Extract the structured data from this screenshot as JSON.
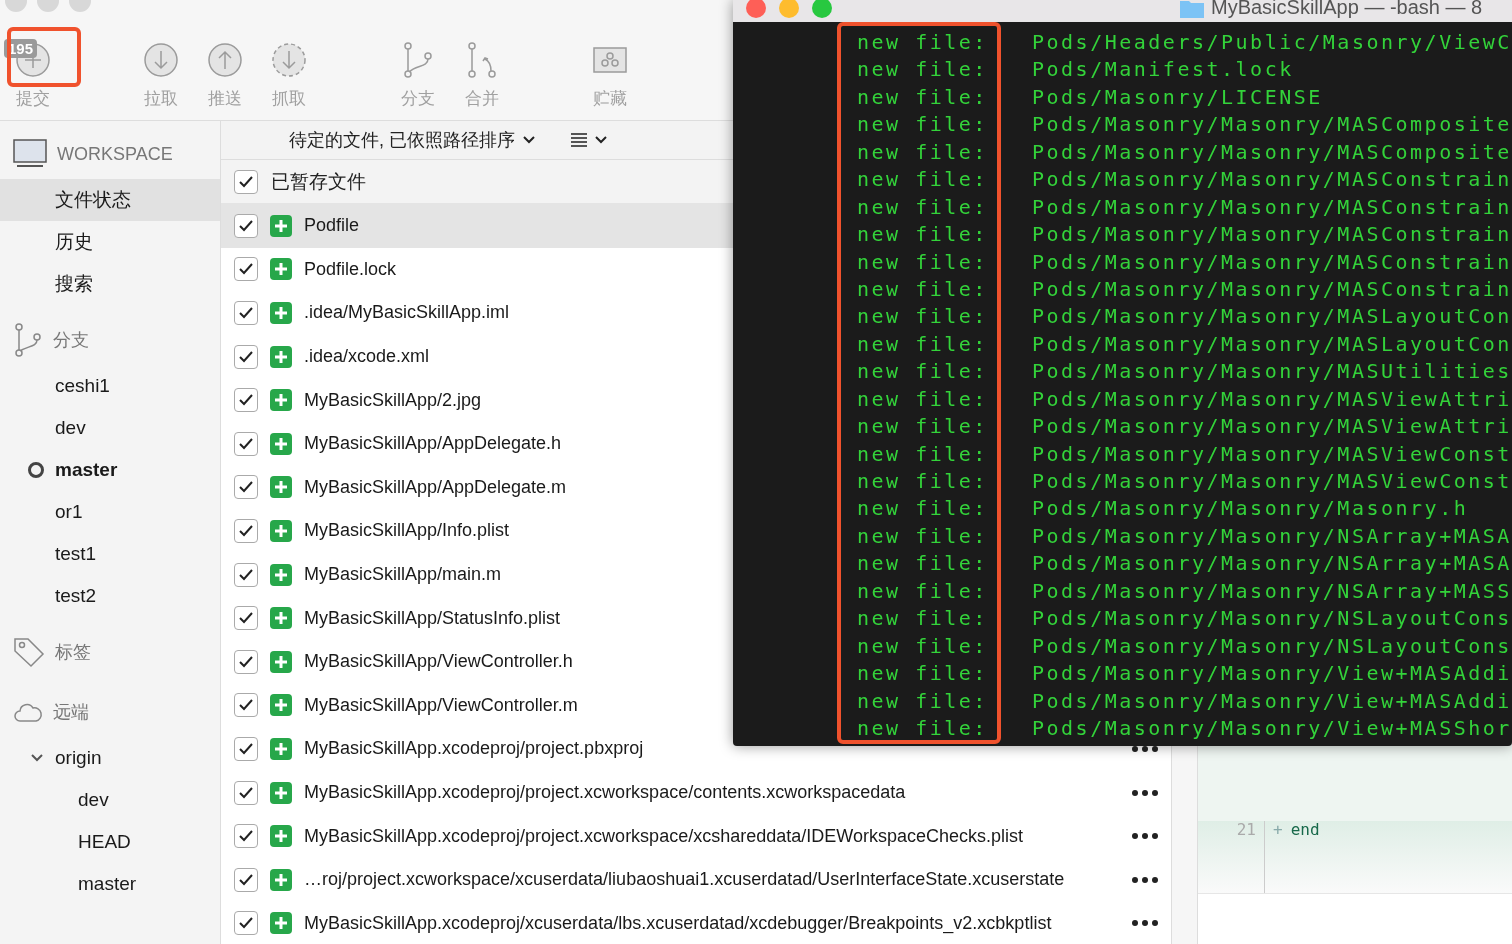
{
  "toolbar": [
    {
      "kind": "commit",
      "label": "提交",
      "badge": "195",
      "highlighted": true
    },
    {
      "kind": "pull",
      "label": "拉取",
      "highlighted": false
    },
    {
      "kind": "push",
      "label": "推送",
      "highlighted": false
    },
    {
      "kind": "fetch",
      "label": "抓取",
      "highlighted": false
    },
    {
      "kind": "branch",
      "label": "分支",
      "highlighted": false
    },
    {
      "kind": "merge",
      "label": "合并",
      "highlighted": false
    },
    {
      "kind": "stash",
      "label": "贮藏",
      "highlighted": false
    }
  ],
  "sidebar": [
    {
      "kind": "workspace",
      "title": "WORKSPACE",
      "items": [
        {
          "label": "文件状态",
          "selected": true
        },
        {
          "label": "历史",
          "selected": false
        },
        {
          "label": "搜索",
          "selected": false
        }
      ]
    },
    {
      "kind": "branches",
      "title": "分支",
      "items": [
        {
          "label": "ceshi1",
          "current": false
        },
        {
          "label": "dev",
          "current": false
        },
        {
          "label": "master",
          "current": true
        },
        {
          "label": "or1",
          "current": false
        },
        {
          "label": "test1",
          "current": false
        },
        {
          "label": "test2",
          "current": false
        }
      ]
    },
    {
      "kind": "tags",
      "title": "标签"
    },
    {
      "kind": "remotes",
      "title": "远端",
      "items": [
        {
          "label": "origin",
          "expanded": true,
          "children": [
            {
              "label": "dev"
            },
            {
              "label": "HEAD"
            },
            {
              "label": "master"
            }
          ]
        }
      ]
    }
  ],
  "file_list": {
    "sort_label": "待定的文件, 已依照路径排序",
    "staged": {
      "label": "已暂存文件",
      "checked": true
    },
    "files": [
      {
        "path": "Podfile",
        "checked": true,
        "selected": true,
        "more": false
      },
      {
        "path": "Podfile.lock",
        "checked": true,
        "selected": false,
        "more": false
      },
      {
        "path": ".idea/MyBasicSkillApp.iml",
        "checked": true,
        "selected": false,
        "more": false
      },
      {
        "path": ".idea/xcode.xml",
        "checked": true,
        "selected": false,
        "more": false
      },
      {
        "path": "MyBasicSkillApp/2.jpg",
        "checked": true,
        "selected": false,
        "more": false
      },
      {
        "path": "MyBasicSkillApp/AppDelegate.h",
        "checked": true,
        "selected": false,
        "more": false
      },
      {
        "path": "MyBasicSkillApp/AppDelegate.m",
        "checked": true,
        "selected": false,
        "more": false
      },
      {
        "path": "MyBasicSkillApp/Info.plist",
        "checked": true,
        "selected": false,
        "more": false
      },
      {
        "path": "MyBasicSkillApp/main.m",
        "checked": true,
        "selected": false,
        "more": false
      },
      {
        "path": "MyBasicSkillApp/StatusInfo.plist",
        "checked": true,
        "selected": false,
        "more": false
      },
      {
        "path": "MyBasicSkillApp/ViewController.h",
        "checked": true,
        "selected": false,
        "more": false
      },
      {
        "path": "MyBasicSkillApp/ViewController.m",
        "checked": true,
        "selected": false,
        "more": false
      },
      {
        "path": "MyBasicSkillApp.xcodeproj/project.pbxproj",
        "checked": true,
        "selected": false,
        "more": true
      },
      {
        "path": "MyBasicSkillApp.xcodeproj/project.xcworkspace/contents.xcworkspacedata",
        "checked": true,
        "selected": false,
        "more": true
      },
      {
        "path": "MyBasicSkillApp.xcodeproj/project.xcworkspace/xcshareddata/IDEWorkspaceChecks.plist",
        "checked": true,
        "selected": false,
        "more": true
      },
      {
        "path": "…roj/project.xcworkspace/xcuserdata/liubaoshuai1.xcuserdatad/UserInterfaceState.xcuserstate",
        "checked": true,
        "selected": false,
        "more": true
      },
      {
        "path": "MyBasicSkillApp.xcodeproj/xcuserdata/lbs.xcuserdatad/xcdebugger/Breakpoints_v2.xcbkptlist",
        "checked": true,
        "selected": false,
        "more": true
      }
    ]
  },
  "diff": {
    "line_number": "21",
    "sign": "+",
    "code": "end"
  },
  "terminal": {
    "title": "MyBasicSkillApp — -bash — 8",
    "highlighted": true,
    "lines": [
      {
        "status": "new file:",
        "path": "Pods/Headers/Public/Masonry/ViewC"
      },
      {
        "status": "new file:",
        "path": "Pods/Manifest.lock"
      },
      {
        "status": "new file:",
        "path": "Pods/Masonry/LICENSE"
      },
      {
        "status": "new file:",
        "path": "Pods/Masonry/Masonry/MASComposite"
      },
      {
        "status": "new file:",
        "path": "Pods/Masonry/Masonry/MASComposite"
      },
      {
        "status": "new file:",
        "path": "Pods/Masonry/Masonry/MASConstrain"
      },
      {
        "status": "new file:",
        "path": "Pods/Masonry/Masonry/MASConstrain"
      },
      {
        "status": "new file:",
        "path": "Pods/Masonry/Masonry/MASConstrain"
      },
      {
        "status": "new file:",
        "path": "Pods/Masonry/Masonry/MASConstrain"
      },
      {
        "status": "new file:",
        "path": "Pods/Masonry/Masonry/MASConstrain"
      },
      {
        "status": "new file:",
        "path": "Pods/Masonry/Masonry/MASLayoutCon"
      },
      {
        "status": "new file:",
        "path": "Pods/Masonry/Masonry/MASLayoutCon"
      },
      {
        "status": "new file:",
        "path": "Pods/Masonry/Masonry/MASUtilities"
      },
      {
        "status": "new file:",
        "path": "Pods/Masonry/Masonry/MASViewAttri"
      },
      {
        "status": "new file:",
        "path": "Pods/Masonry/Masonry/MASViewAttri"
      },
      {
        "status": "new file:",
        "path": "Pods/Masonry/Masonry/MASViewConst"
      },
      {
        "status": "new file:",
        "path": "Pods/Masonry/Masonry/MASViewConst"
      },
      {
        "status": "new file:",
        "path": "Pods/Masonry/Masonry/Masonry.h"
      },
      {
        "status": "new file:",
        "path": "Pods/Masonry/Masonry/NSArray+MASA"
      },
      {
        "status": "new file:",
        "path": "Pods/Masonry/Masonry/NSArray+MASA"
      },
      {
        "status": "new file:",
        "path": "Pods/Masonry/Masonry/NSArray+MASS"
      },
      {
        "status": "new file:",
        "path": "Pods/Masonry/Masonry/NSLayoutCons"
      },
      {
        "status": "new file:",
        "path": "Pods/Masonry/Masonry/NSLayoutCons"
      },
      {
        "status": "new file:",
        "path": "Pods/Masonry/Masonry/View+MASAddi"
      },
      {
        "status": "new file:",
        "path": "Pods/Masonry/Masonry/View+MASAddi"
      },
      {
        "status": "new file:",
        "path": "Pods/Masonry/Masonry/View+MASShor"
      }
    ]
  }
}
